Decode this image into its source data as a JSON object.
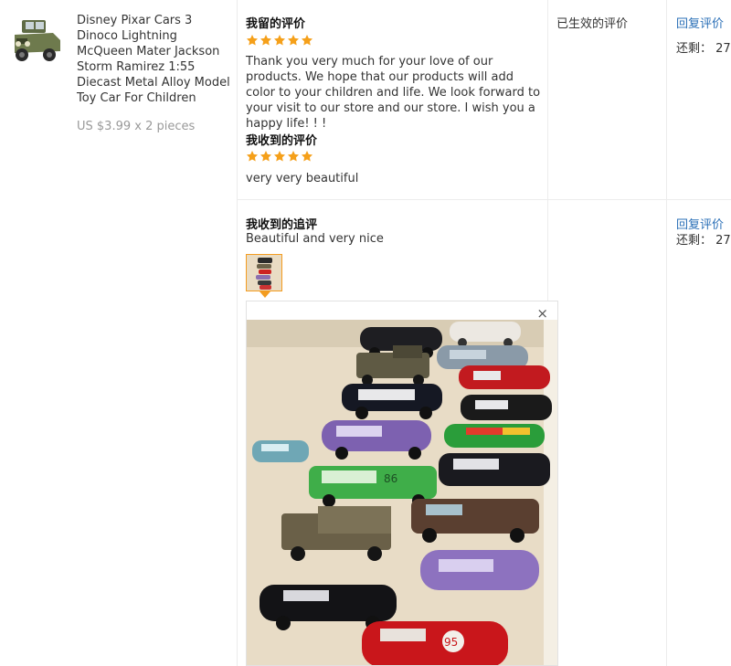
{
  "product": {
    "title": "Disney Pixar Cars 3 Dinoco Lightning McQueen Mater Jackson Storm Ramirez 1:55 Diecast Metal Alloy Model Toy Car For Children",
    "price": "US $3.99 x 2 pieces",
    "image_icon": "toy-jeep-image"
  },
  "feedback": {
    "my_review_label": "我留的评价",
    "my_review_stars": 5,
    "my_review_text": "Thank you very much for your love of our products. We hope that our products will add color to your children and life. We look forward to your visit to our store and our store. I wish you a happy life! ! !",
    "received_label": "我收到的评价",
    "received_stars": 5,
    "received_text": "very very beautiful",
    "followup_label": "我收到的追评",
    "followup_text": "Beautiful and very nice"
  },
  "status": {
    "effective": "已生效的评价"
  },
  "actions": {
    "reply_label": "回复评价",
    "remaining_1": "还剩： 27",
    "reply_label_2": "回复评价",
    "remaining_2": "还剩： 27"
  },
  "preview": {
    "close_glyph": "×",
    "photo_subject": "toy-cars-photo"
  },
  "colors": {
    "star": "#f5a01a",
    "link": "#2a6fb7",
    "accent_border": "#f39c20"
  }
}
